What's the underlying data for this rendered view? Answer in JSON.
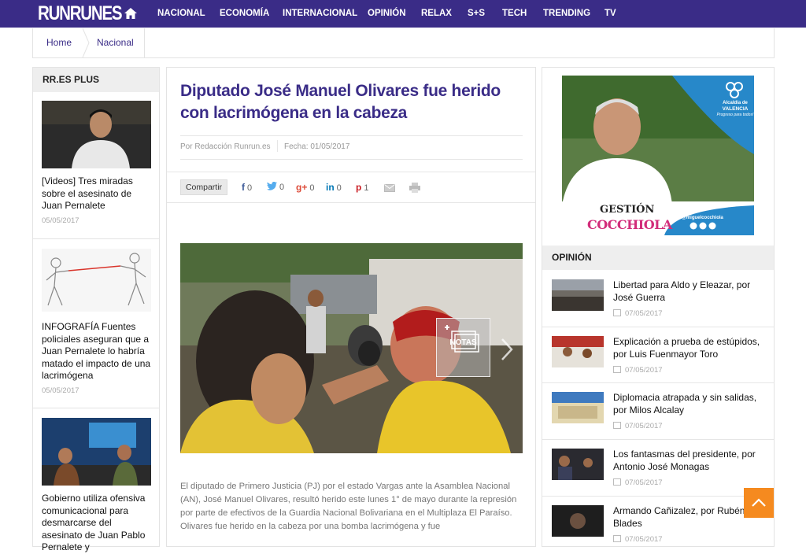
{
  "header": {
    "logo": "RUNRUNES",
    "nav": [
      "NACIONAL",
      "ECONOMÍA",
      "INTERNACIONAL",
      "OPINIÓN",
      "RELAX",
      "S+S",
      "TECH",
      "TRENDING",
      "TV"
    ]
  },
  "breadcrumb": {
    "home": "Home",
    "section": "Nacional"
  },
  "left_box": {
    "title": "RR.ES PLUS",
    "items": [
      {
        "title": "[Videos] Tres miradas sobre el asesinato de Juan Pernalete",
        "date": "05/05/2017"
      },
      {
        "title": "INFOGRAFÍA Fuentes policiales aseguran que a Juan Pernalete lo habría matado el impacto de una lacrimógena",
        "date": "05/05/2017"
      },
      {
        "title": "Gobierno utiliza ofensiva comunicacional para desmarcarse del asesinato de Juan Pablo Pernalete y",
        "date": ""
      }
    ]
  },
  "article": {
    "title": "Diputado José Manuel Olivares fue herido con lacrimógena en la cabeza",
    "author": "Por Redacción Runrun.es",
    "date": "Fecha: 01/05/2017",
    "share_label": "Compartir",
    "social": {
      "facebook": {
        "icon": "f",
        "count": "0"
      },
      "twitter": {
        "icon": "twitter-bird",
        "count": "0"
      },
      "googleplus": {
        "icon": "g+",
        "count": "0"
      },
      "linkedin": {
        "icon": "in",
        "count": "0"
      },
      "pinterest": {
        "icon": "p",
        "count": "1"
      }
    },
    "photo_overlay": "NOTAS",
    "body": "El diputado de Primero Justicia (PJ) por el estado Vargas ante la Asamblea Nacional (AN), José Manuel Olivares, resultó herido este lunes 1° de mayo durante la represión por parte de efectivos de la Guardia Nacional Bolivariana en el Multiplaza El Paraíso. Olivares fue herido en la cabeza por una bomba lacrimógena y fue"
  },
  "ad": {
    "brand_top": "Alcaldía de",
    "brand_city": "VALENCIA",
    "brand_tagline": "Progreso para todos!",
    "gestion": "GESTIÓN",
    "name": "COCCHIOLA",
    "handle": "@miguelcocchiola"
  },
  "opinion": {
    "title": "OPINIÓN",
    "items": [
      {
        "title": "Libertad para Aldo y Eleazar, por José Guerra",
        "date": "07/05/2017"
      },
      {
        "title": "Explicación a prueba de estúpidos, por Luis Fuenmayor Toro",
        "date": "07/05/2017"
      },
      {
        "title": "Diplomacia atrapada y sin salidas, por Milos Alcalay",
        "date": "07/05/2017"
      },
      {
        "title": "Los fantasmas del presidente, por Antonio José Monagas",
        "date": "07/05/2017"
      },
      {
        "title": "Armando Cañizalez, por Rubén Blades",
        "date": "07/05/2017"
      }
    ]
  },
  "colors": {
    "brand": "#3a2c87",
    "accent": "#f58a1f"
  }
}
